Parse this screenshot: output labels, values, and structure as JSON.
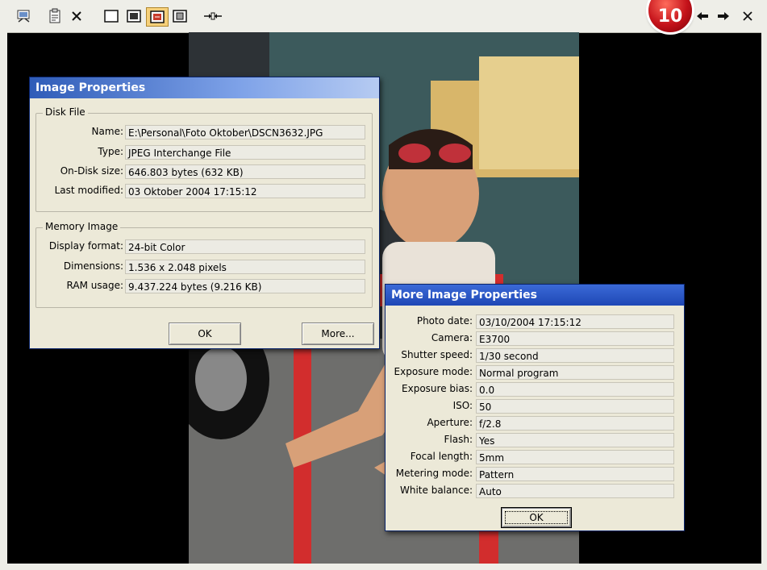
{
  "badge": "10",
  "image_properties": {
    "title": "Image Properties",
    "disk_group": "Disk File",
    "disk_rows": [
      {
        "label": "Name:",
        "value": "E:\\Personal\\Foto Oktober\\DSCN3632.JPG"
      },
      {
        "label": "Type:",
        "value": "JPEG Interchange File"
      },
      {
        "label": "On-Disk size:",
        "value": "646.803 bytes (632 KB)"
      },
      {
        "label": "Last modified:",
        "value": "03 Oktober 2004 17:15:12"
      }
    ],
    "memory_group": "Memory Image",
    "memory_rows": [
      {
        "label": "Display format:",
        "value": "24-bit Color"
      },
      {
        "label": "Dimensions:",
        "value": "1.536 x 2.048 pixels"
      },
      {
        "label": "RAM usage:",
        "value": "9.437.224 bytes (9.216 KB)"
      }
    ],
    "ok_label": "OK",
    "more_label": "More..."
  },
  "more_properties": {
    "title": "More Image Properties",
    "rows": [
      {
        "label": "Photo date:",
        "value": "03/10/2004 17:15:12"
      },
      {
        "label": "Camera:",
        "value": "E3700"
      },
      {
        "label": "Shutter speed:",
        "value": "1/30 second"
      },
      {
        "label": "Exposure mode:",
        "value": "Normal program"
      },
      {
        "label": "Exposure bias:",
        "value": "0.0"
      },
      {
        "label": "ISO:",
        "value": "50"
      },
      {
        "label": "Aperture:",
        "value": "f/2.8"
      },
      {
        "label": "Flash:",
        "value": "Yes"
      },
      {
        "label": "Focal length:",
        "value": "5mm"
      },
      {
        "label": "Metering mode:",
        "value": "Pattern"
      },
      {
        "label": "White balance:",
        "value": "Auto"
      }
    ],
    "ok_label": "OK"
  },
  "toolbar_icons": [
    "slideshow-icon",
    "properties-icon",
    "close-icon",
    "fit-window-icon",
    "fit-width-icon",
    "actual-size-icon",
    "zoom-fit-icon",
    "stretch-icon",
    "previous-arrow-icon",
    "next-arrow-icon",
    "close-viewer-icon"
  ],
  "colors": {
    "title_bar": "#2f5cb8",
    "badge": "#c4121a",
    "dialog_bg": "#ece9d8"
  }
}
